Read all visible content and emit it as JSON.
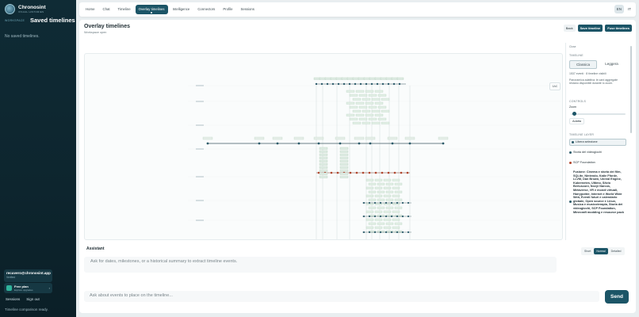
{
  "app": {
    "name": "Chronosint",
    "tagline": "VISUAL HISTORIES"
  },
  "sidebar": {
    "workspace_label": "WORKSPACE",
    "saved_title": "Saved timelines",
    "empty_text": "No saved timelines.",
    "user_email": "recuvero@chronosint.app",
    "user_status": "Verified",
    "plan_name": "Free plan",
    "plan_sub": "Explore upgrades",
    "links": [
      "Sessions",
      "Sign out"
    ],
    "status_text": "Timeline comparison ready."
  },
  "nav": {
    "tabs": [
      "Home",
      "Chat",
      "Timeline",
      "Overlay timelines",
      "Intelligence",
      "Connectors",
      "Profile",
      "Sessions"
    ],
    "active_tab": "Overlay timelines",
    "languages": [
      "EN",
      "IT"
    ],
    "active_language": "EN"
  },
  "main": {
    "title": "Overlay timelines",
    "subtitle": "Workspace open",
    "buttons": {
      "back": "Back",
      "save": "Save timeline",
      "fuse": "Fuse timelines"
    },
    "canvas_button": "1AC"
  },
  "right_panel": {
    "close": "Close",
    "timeline_label": "TIMELINE",
    "view_modes": [
      "Classica",
      "Leggera"
    ],
    "active_view": "Classica",
    "events_info": "1537 eventi · 8 timeline visibili",
    "overview_text": "Panoramica adattiva: le card aggregate restano disponibili durante lo zoom.",
    "controls_label": "CONTROLS",
    "zoom_label": "Zoom",
    "zoom_value": 0.05,
    "fit_label": "Adatta",
    "layers_label": "TIMELINE LAYER",
    "layers": [
      {
        "label": "Libera selezione",
        "color": "#2d5c6b",
        "selected": true
      },
      {
        "label": "Storia del videogiochi",
        "color": "#2d5c6b",
        "selected": false
      },
      {
        "label": "SCP Foundation",
        "color": "#b0442c",
        "selected": false
      },
      {
        "label": "Fusione: Cinema e storia dei film, SQLite, Nintendo, Katie Fforde, LLVM, Dan Brown, Unreal Engine, Kubernetes, Ultimo, Silvio Berlusconi, Novyi Narcos, Metaverse, VR e mondi virtuali, Harrypotter, Internet e World Wide Web, Eventi futuri e calendario globale, Open source e Linux, Musica e musicoterapia, Storia dei videogiochi, SCP Foundation, Minecraft modding e resource pack",
        "color": "#2d5c6b",
        "selected": false
      }
    ]
  },
  "assistant": {
    "title": "Assistant",
    "modes": [
      "Short",
      "Normal",
      "Detailed"
    ],
    "active_mode": "Normal",
    "prompt_placeholder": "Ask for dates, milestones, or a historical summary to extract timeline events.",
    "input_placeholder": "Ask about events to place on the timeline...",
    "send_label": "Send"
  },
  "colors": {
    "sidebar_bg": "#0f2b35",
    "accent": "#1c5567",
    "node_green": "#7fae8c",
    "node_red": "#b0442c"
  }
}
